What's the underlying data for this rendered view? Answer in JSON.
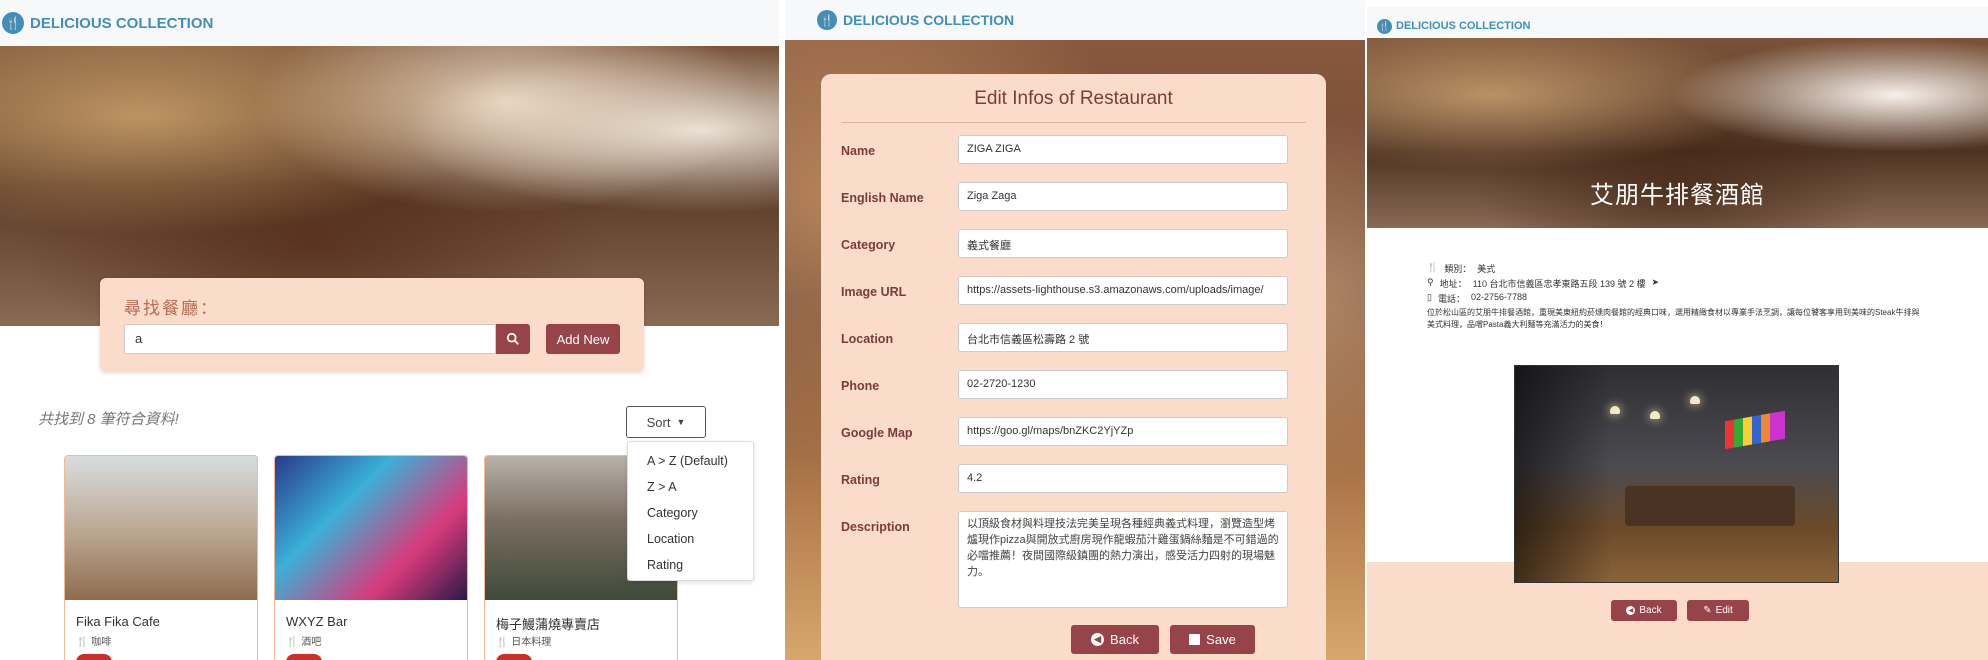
{
  "brand": "DELICIOUS COLLECTION",
  "list_page": {
    "search_title": "尋找餐廳：",
    "search_value": "a",
    "add_label": "Add New",
    "result_text": "共找到 8 筆符合資料!",
    "sort_label": "Sort",
    "sort_options": [
      "A > Z (Default)",
      "Z > A",
      "Category",
      "Location",
      "Rating"
    ],
    "cards": [
      {
        "name": "Fika Fika Cafe",
        "category": "咖啡"
      },
      {
        "name": "WXYZ Bar",
        "category": "酒吧"
      },
      {
        "name": "梅子鰻蒲燒專賣店",
        "category": "日本料理"
      }
    ]
  },
  "edit_page": {
    "title": "Edit Infos of Restaurant",
    "fields": [
      {
        "label": "Name",
        "value": "ZIGA ZIGA"
      },
      {
        "label": "English Name",
        "value": "Ziga Zaga"
      },
      {
        "label": "Category",
        "value": "義式餐廳"
      },
      {
        "label": "Image URL",
        "value": "https://assets-lighthouse.s3.amazonaws.com/uploads/image/"
      },
      {
        "label": "Location",
        "value": "台北市信義區松壽路 2 號"
      },
      {
        "label": "Phone",
        "value": "02-2720-1230"
      },
      {
        "label": "Google Map",
        "value": "https://goo.gl/maps/bnZKC2YjYZp"
      },
      {
        "label": "Rating",
        "value": "4.2"
      }
    ],
    "description_label": "Description",
    "description_value": "以頂級食材與料理技法完美呈現各種經典義式料理，瀏覽造型烤爐現作pizza與開放式廚房現作龍蝦茄汁雞蛋鍋絲麵是不可錯過的必噹推薦！夜間國際級鎮團的熱力演出，感受活力四射的現場魅力。",
    "back_label": "Back",
    "save_label": "Save"
  },
  "detail_page": {
    "title": "艾朋牛排餐酒館",
    "category_label": "類別：",
    "category": "美式",
    "address_label": "地址：",
    "address": "110 台北市信義區忠孝東路五段 139 號 2 樓",
    "phone_label": "電話：",
    "phone": "02-2756-7788",
    "description": "位於松山區的艾朋牛排餐酒館，重現美東紐約菸燻肉餐館的經典口味，選用精緻食材以專業手法烹調，讓每位饕客享用到美味的Steak牛排與美式料理，品嚐Pasta義大利麵等充滿活力的美食！",
    "back_label": "Back",
    "edit_label": "Edit"
  }
}
